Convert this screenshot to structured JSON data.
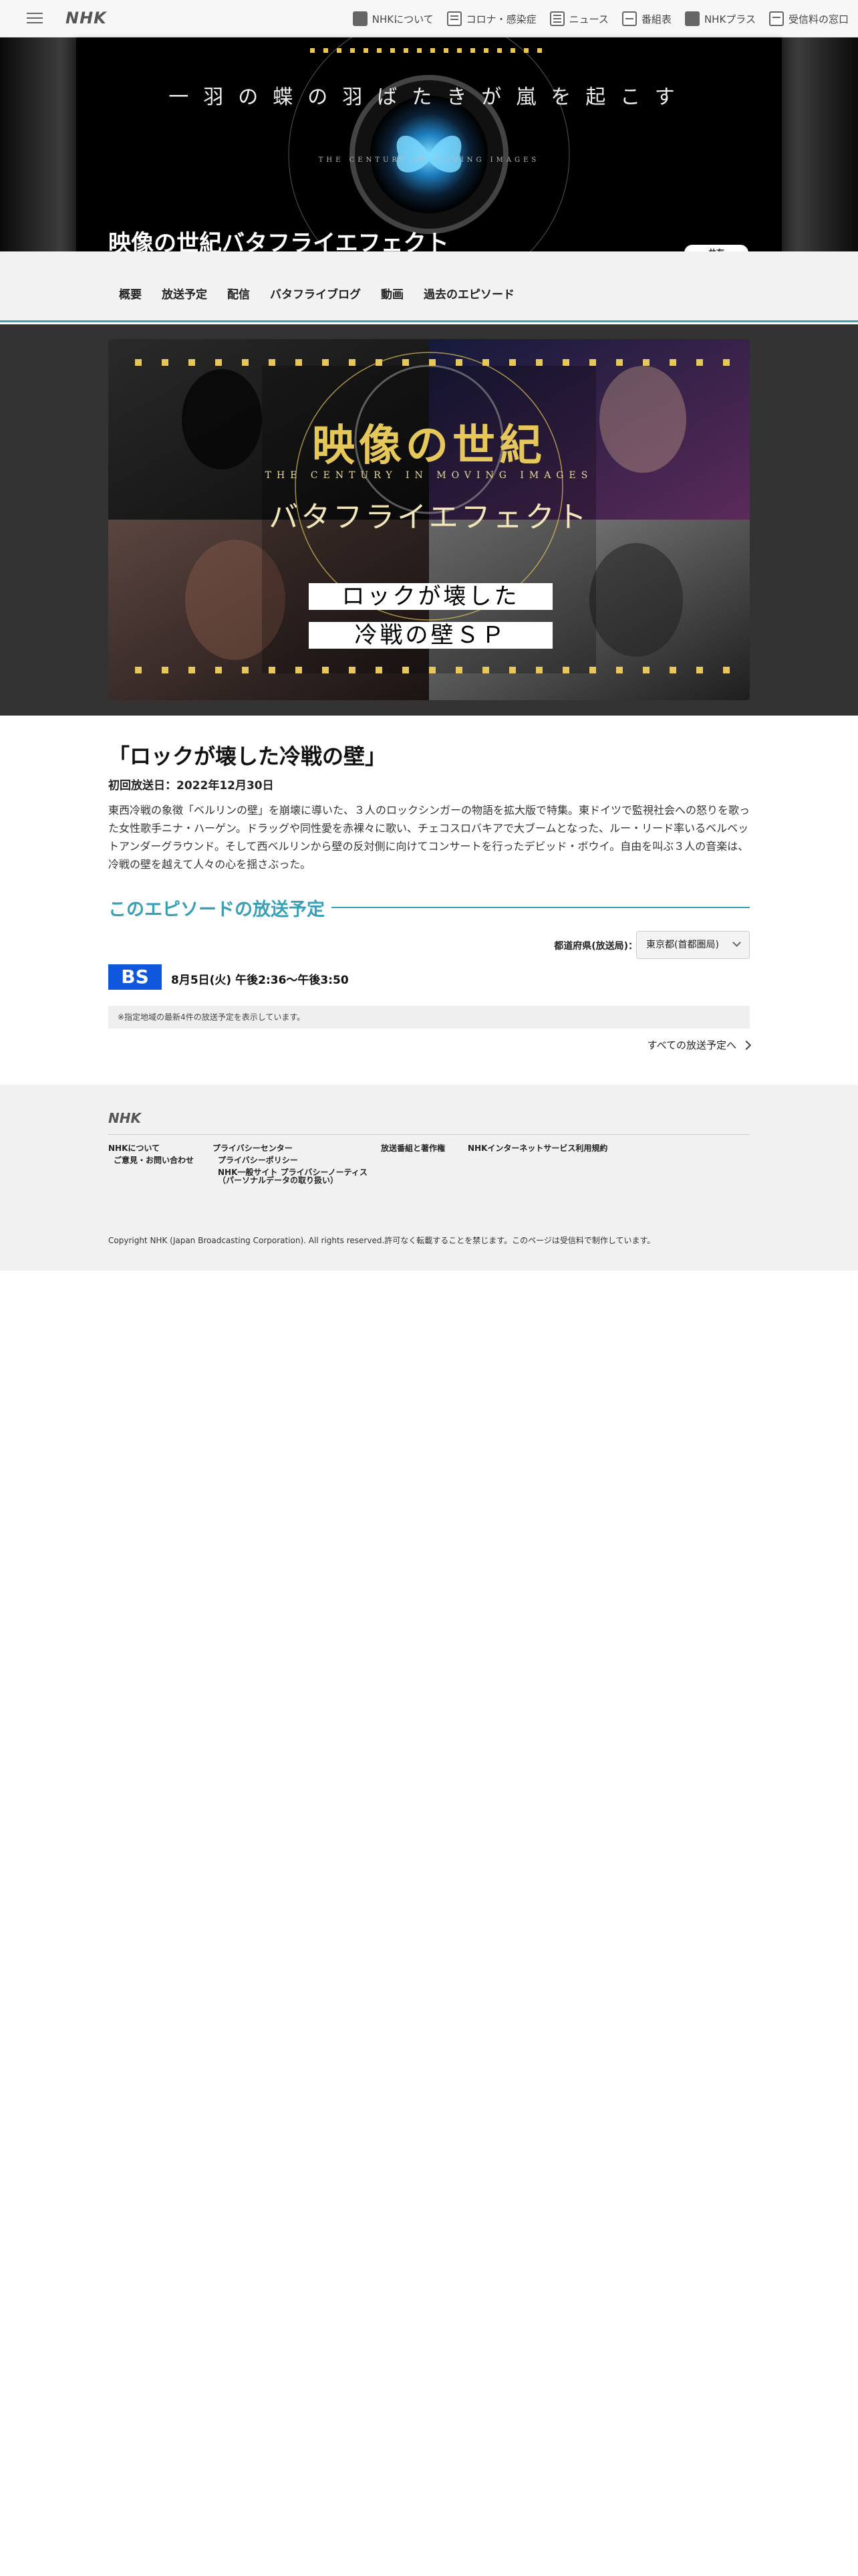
{
  "header": {
    "logo": "NHK",
    "nav": [
      {
        "label": "NHKについて",
        "icon": "nhk-info-icon"
      },
      {
        "label": "コロナ・感染症",
        "icon": "corona-icon"
      },
      {
        "label": "ニュース",
        "icon": "news-icon"
      },
      {
        "label": "番組表",
        "icon": "program-guide-icon"
      },
      {
        "label": "NHKプラス",
        "icon": "nhk-plus-icon"
      },
      {
        "label": "受信料の窓口",
        "icon": "fee-window-icon"
      }
    ]
  },
  "hero": {
    "tagline": "一羽の蝶の羽ばたきが嵐を起こす",
    "subtitle": "THE CENTURY IN MOVING IMAGES",
    "title": "映像の世紀バタフライエフェクト",
    "share_label": "共有"
  },
  "subnav": [
    "概要",
    "放送予定",
    "配信",
    "バタフライブログ",
    "動画",
    "過去のエピソード"
  ],
  "banner": {
    "title_main": "映像の世紀",
    "title_en": "THE CENTURY IN MOVING IMAGES",
    "title_sub": "バタフライエフェクト",
    "episode_line1": "ロックが壊した",
    "episode_line2": "冷戦の壁ＳＰ"
  },
  "episode": {
    "title": "「ロックが壊した冷戦の壁」",
    "first_aired": "初回放送日：2022年12月30日",
    "description": "東西冷戦の象徴「ベルリンの壁」を崩壊に導いた、３人のロックシンガーの物語を拡大版で特集。東ドイツで監視社会への怒りを歌った女性歌手ニナ・ハーゲン。ドラッグや同性愛を赤裸々に歌い、チェコスロバキアで大ブームとなった、ルー・リード率いるベルベットアンダーグラウンド。そして西ベルリンから壁の反対側に向けてコンサートを行ったデビッド・ボウイ。自由を叫ぶ３人の音楽は、冷戦の壁を越えて人々の心を揺さぶった。"
  },
  "schedule": {
    "heading": "このエピソードの放送予定",
    "pref_label": "都道府県(放送局)：",
    "pref_value": "東京都(首都圏局)",
    "channel": "BS",
    "channel_color": "#0f57dc",
    "time": "8月5日(火) 午後2:36〜午後3:50",
    "note": "※指定地域の最新4件の放送予定を表示しています。",
    "all_link": "すべての放送予定へ"
  },
  "footer": {
    "logo": "NHK",
    "links": {
      "about": "NHKについて",
      "contact": "ご意見・お問い合わせ",
      "privacy_center": "プライバシーセンター",
      "privacy_policy": "プライバシーポリシー",
      "privacy_notice_1": "NHK一般サイト プライバシーノーティス",
      "privacy_notice_2": "（パーソナルデータの取り扱い）",
      "copyright_programs": "放送番組と著作権",
      "internet_terms": "NHKインターネットサービス利用規約"
    },
    "copyright": "Copyright NHK (Japan Broadcasting Corporation). All rights reserved.許可なく転載することを禁じます。このページは受信料で制作しています。"
  },
  "colors": {
    "accent": "#3aa0b8",
    "gold": "#e6c75a",
    "banner_bg": "#333333"
  }
}
